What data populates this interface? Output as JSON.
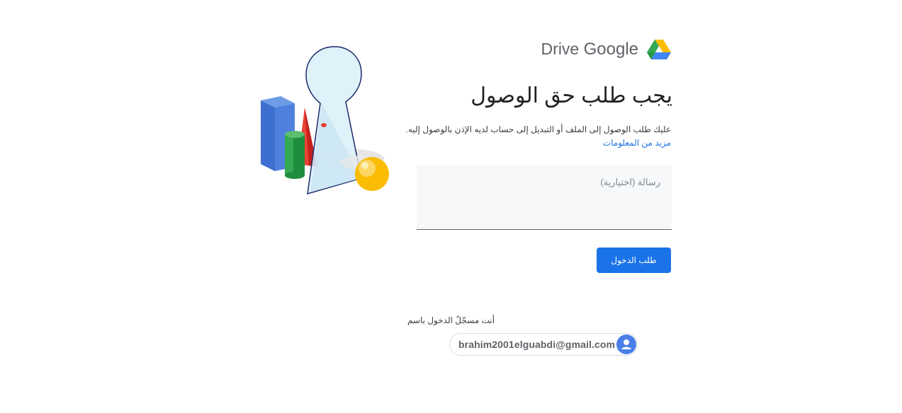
{
  "brand": {
    "product": "Drive",
    "company": "Google",
    "icon": "google-drive-logo-icon"
  },
  "main": {
    "title": "يجب طلب حق الوصول",
    "description": "عليك طلب الوصول إلى الملف أو التبديل إلى حساب لديه الإذن بالوصول إليه.",
    "learn_more": "مزيد من المعلومات",
    "message_placeholder": "رسالة (اختيارية)",
    "message_value": "",
    "request_button": "طلب الدخول"
  },
  "account": {
    "signed_in_label": "أنت مسجّلٌ الدخول باسم",
    "email": "brahim2001elguabdi@gmail.com",
    "avatar_icon": "person-avatar-icon"
  },
  "colors": {
    "accent": "#1a73e8",
    "text": "#202124",
    "muted": "#5f6368"
  }
}
